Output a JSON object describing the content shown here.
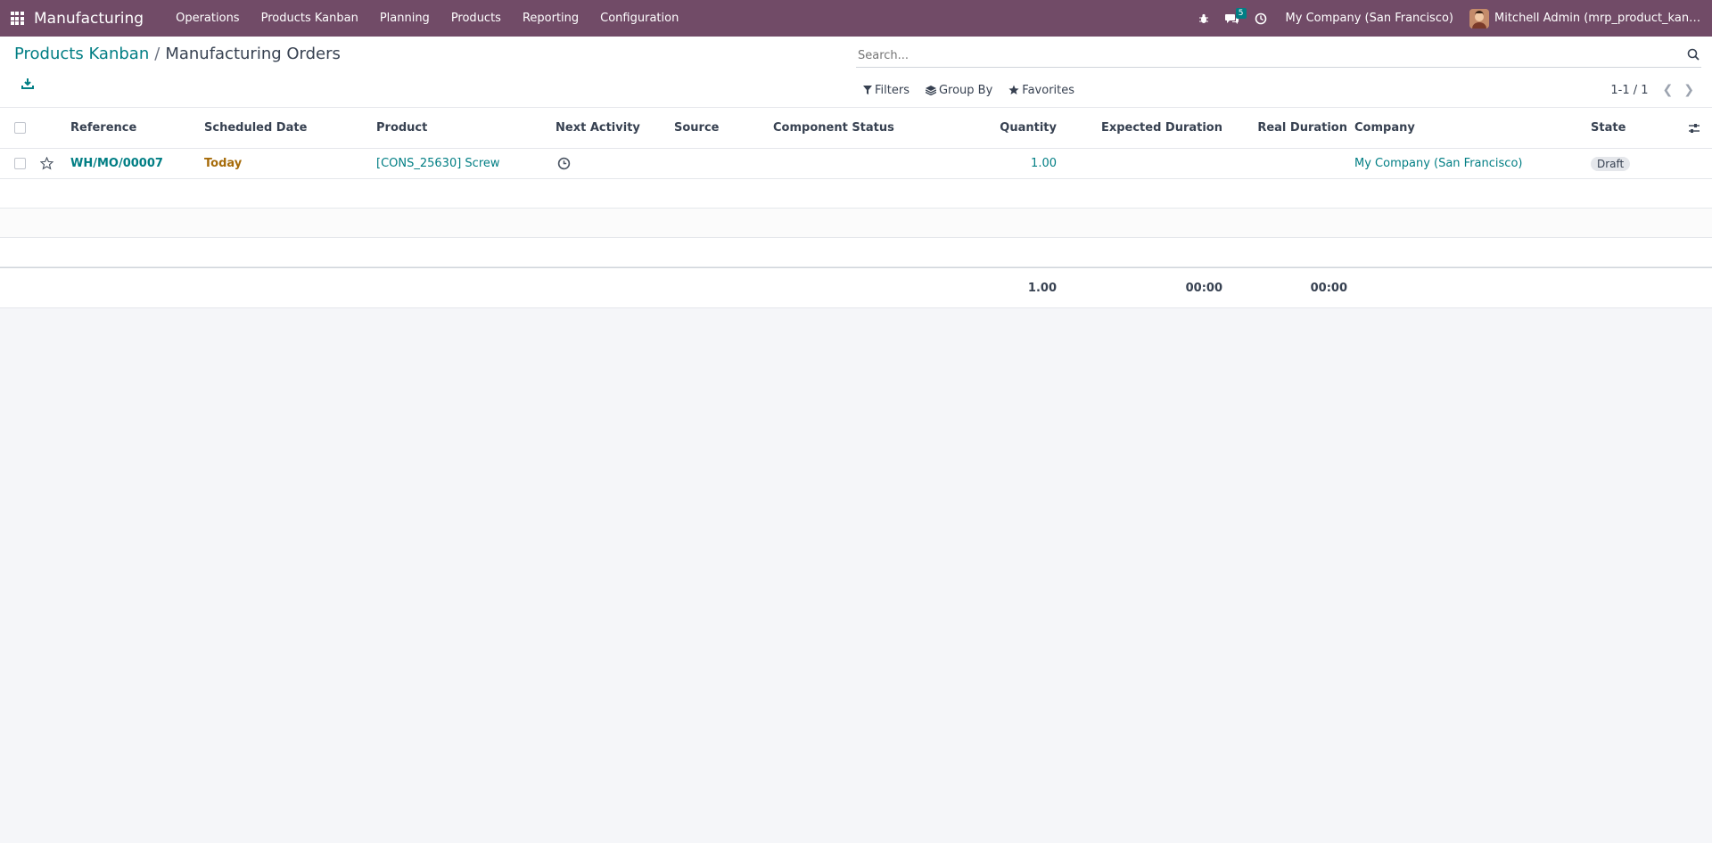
{
  "navbar": {
    "app_name": "Manufacturing",
    "menu": [
      "Operations",
      "Products Kanban",
      "Planning",
      "Products",
      "Reporting",
      "Configuration"
    ],
    "message_count": "5",
    "company": "My Company (San Francisco)",
    "user": "Mitchell Admin (mrp_product_kanban…"
  },
  "breadcrumb": {
    "parent": "Products Kanban",
    "separator": "/",
    "current": "Manufacturing Orders"
  },
  "search": {
    "placeholder": "Search...",
    "value": ""
  },
  "search_actions": {
    "filters": "Filters",
    "group_by": "Group By",
    "favorites": "Favorites"
  },
  "pager": {
    "value": "1-1 / 1"
  },
  "table": {
    "columns": {
      "reference": "Reference",
      "scheduled_date": "Scheduled Date",
      "product": "Product",
      "next_activity": "Next Activity",
      "source": "Source",
      "component_status": "Component Status",
      "quantity": "Quantity",
      "expected_duration": "Expected Duration",
      "real_duration": "Real Duration",
      "company": "Company",
      "state": "State"
    },
    "rows": [
      {
        "reference": "WH/MO/00007",
        "scheduled_date": "Today",
        "product": "[CONS_25630] Screw",
        "source": "",
        "component_status": "",
        "quantity": "1.00",
        "expected_duration": "",
        "real_duration": "",
        "company": "My Company (San Francisco)",
        "state": "Draft"
      }
    ],
    "totals": {
      "quantity": "1.00",
      "expected_duration": "00:00",
      "real_duration": "00:00"
    }
  },
  "colors": {
    "navbar": "#714b67",
    "accent": "#017e84",
    "today": "#a66b09"
  }
}
